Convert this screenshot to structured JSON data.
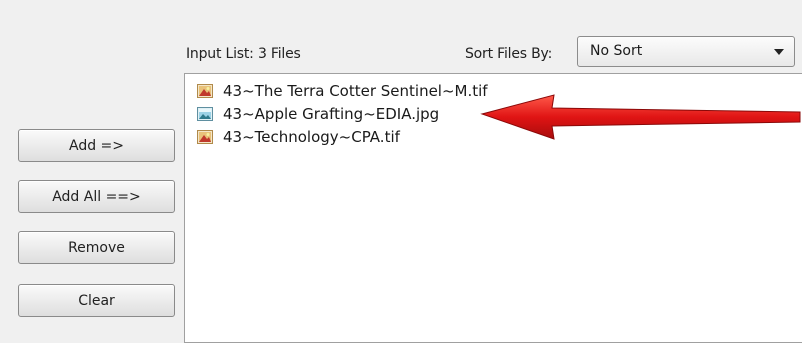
{
  "header": {
    "input_list_label": "Input List: 3 Files",
    "sort_label": "Sort Files By:"
  },
  "sort_select": {
    "value": "No Sort"
  },
  "file_list": [
    {
      "name": "43~The Terra Cotter Sentinel~M.tif",
      "icon": "tif-image-icon"
    },
    {
      "name": "43~Apple Grafting~EDIA.jpg",
      "icon": "jpg-image-icon"
    },
    {
      "name": "43~Technology~CPA.tif",
      "icon": "tif-image-icon"
    }
  ],
  "buttons": {
    "add": "Add =>",
    "add_all": "Add All ==>",
    "remove": "Remove",
    "clear": "Clear"
  },
  "colors": {
    "arrow": "#e01414"
  }
}
